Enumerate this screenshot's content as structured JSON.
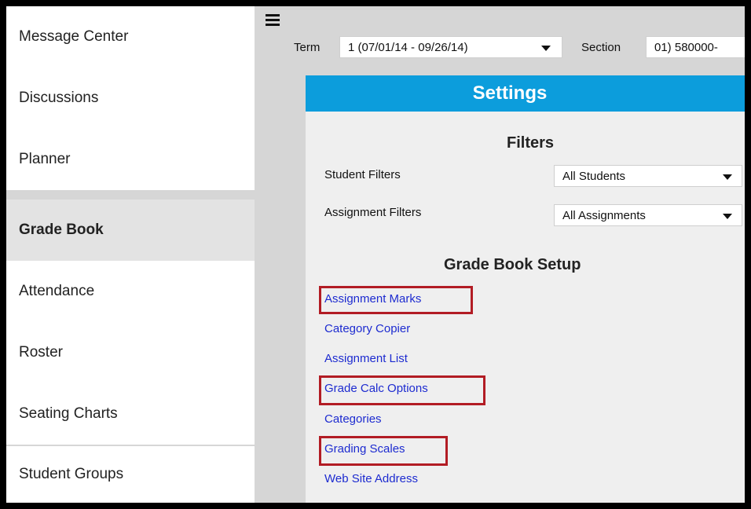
{
  "sidebar": {
    "items": [
      {
        "label": "Message Center"
      },
      {
        "label": "Discussions"
      },
      {
        "label": "Planner"
      },
      {
        "label": "Grade Book",
        "active": true
      },
      {
        "label": "Attendance"
      },
      {
        "label": "Roster"
      },
      {
        "label": "Seating Charts"
      },
      {
        "label": "Student Groups"
      }
    ]
  },
  "topbar": {
    "term_label": "Term",
    "term_value": "1 (07/01/14 - 09/26/14)",
    "section_label": "Section",
    "section_value": "01) 580000-"
  },
  "settings": {
    "title": "Settings",
    "filters_title": "Filters",
    "student_filters_label": "Student Filters",
    "student_filters_value": "All Students",
    "assignment_filters_label": "Assignment Filters",
    "assignment_filters_value": "All Assignments",
    "setup_title": "Grade Book Setup",
    "links": [
      {
        "label": "Assignment Marks",
        "highlighted": true
      },
      {
        "label": "Category Copier",
        "highlighted": false
      },
      {
        "label": "Assignment List",
        "highlighted": false
      },
      {
        "label": "Grade Calc Options",
        "highlighted": true
      },
      {
        "label": "Categories",
        "highlighted": false
      },
      {
        "label": "Grading Scales",
        "highlighted": true
      },
      {
        "label": "Web Site Address",
        "highlighted": false
      }
    ]
  },
  "colors": {
    "header_blue": "#0c9ddc",
    "link_blue": "#1d2bd0",
    "highlight_red": "#b21c24"
  }
}
